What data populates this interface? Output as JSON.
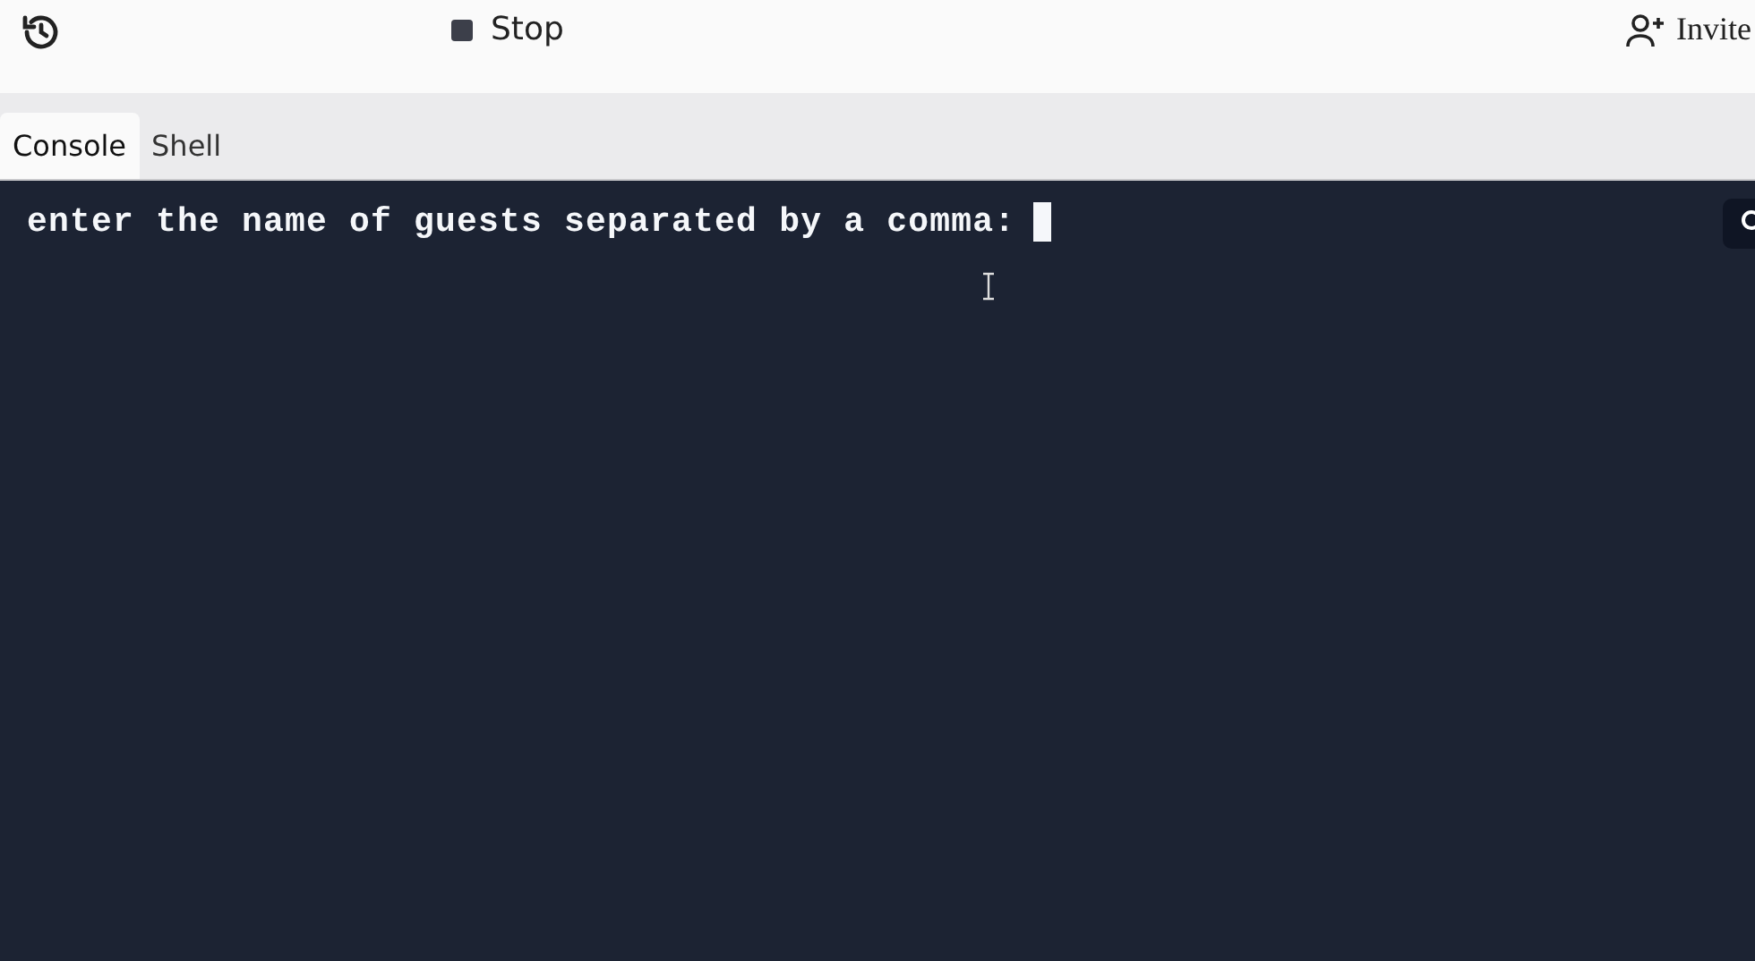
{
  "toolbar": {
    "stop_label": "Stop",
    "invite_label": "Invite"
  },
  "tabs": [
    {
      "label": "Console",
      "selected": true
    },
    {
      "label": "Shell",
      "selected": false
    }
  ],
  "console": {
    "prompt": "enter the name of guests separated by a comma:",
    "cursor_visible": true
  }
}
